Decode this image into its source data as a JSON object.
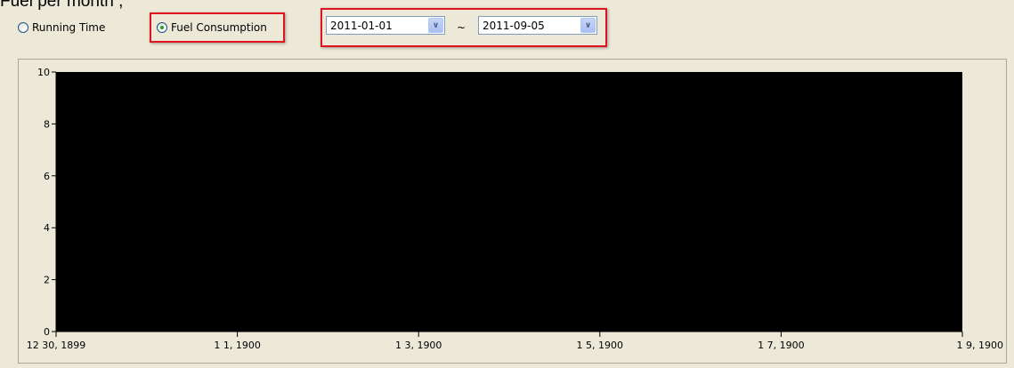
{
  "header": {
    "partial_text": "Fuel per month , "
  },
  "mode_selector": {
    "options": [
      {
        "label": "Running Time",
        "selected": false
      },
      {
        "label": "Fuel Consumption",
        "selected": true
      }
    ]
  },
  "date_range": {
    "start": "2011-01-01",
    "separator": "~",
    "end": "2011-09-05"
  },
  "chart_data": {
    "type": "area",
    "plot_background": "#000000",
    "ylim": [
      0,
      10
    ],
    "y_ticks": [
      "0",
      "2",
      "4",
      "6",
      "8",
      "10"
    ],
    "x_ticks": [
      "12 30, 1899",
      "1 1, 1900",
      "1 3, 1900",
      "1 5, 1900",
      "1 7, 1900",
      "1 9, 1900"
    ],
    "series": []
  },
  "colors": {
    "background": "#ece9d8",
    "highlight": "#e0141e",
    "plot": "#000000"
  }
}
